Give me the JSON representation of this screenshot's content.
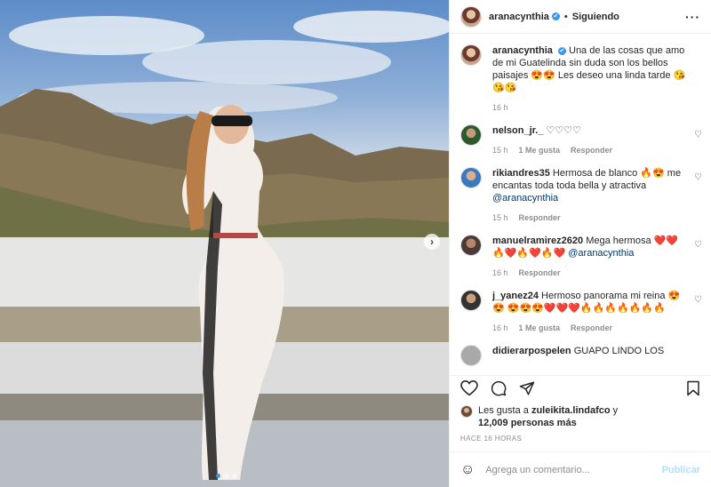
{
  "header": {
    "username": "aranacynthia",
    "verified_mark": "✔",
    "separator": "•",
    "follow_status": "Siguiendo",
    "more_label": "···"
  },
  "caption": {
    "username": "aranacynthia",
    "text": "Una de las cosas que amo de mi Guatelinda sin duda son los bellos paisajes 😍😍 Les deseo una linda tarde 😘😘😘",
    "time": "16 h"
  },
  "comments": [
    {
      "username": "nelson_jr._",
      "text": "♡♡♡♡",
      "mention": "",
      "time": "15 h",
      "likes": "1 Me gusta",
      "reply": "Responder"
    },
    {
      "username": "rikiandres35",
      "text": "Hermosa de blanco 🔥😍 me encantas toda toda bella y atractiva",
      "mention": "@aranacynthia",
      "time": "15 h",
      "likes": "",
      "reply": "Responder"
    },
    {
      "username": "manuelramirez2620",
      "text": "Mega hermosa ❤️❤️ 🔥❤️🔥❤️🔥❤️",
      "mention": "@aranacynthia",
      "time": "16 h",
      "likes": "",
      "reply": "Responder"
    },
    {
      "username": "j_yanez24",
      "text": "Hermoso panorama mi reina 😍😍 😍😍😍❤️❤️❤️🔥🔥🔥🔥🔥🔥🔥",
      "mention": "",
      "time": "16 h",
      "likes": "1 Me gusta",
      "reply": "Responder"
    },
    {
      "username": "didierarpospelen",
      "text": "GUAPO LINDO LOS",
      "mention": "",
      "time": "",
      "likes": "",
      "reply": ""
    }
  ],
  "likes": {
    "prefix": "Les gusta a",
    "user": "zuleikita.lindafco",
    "join": "y",
    "count": "12,009 personas más"
  },
  "timestamp": "HACE 16 HORAS",
  "add_comment": {
    "placeholder": "Agrega un comentario...",
    "publish": "Publicar"
  },
  "carousel": {
    "next_icon": "›",
    "total": 3,
    "active": 1
  },
  "colors": {
    "accent": "#3897f0",
    "link": "#00376b",
    "muted": "#8e8e8e",
    "publish_disabled": "#b2dffc"
  }
}
